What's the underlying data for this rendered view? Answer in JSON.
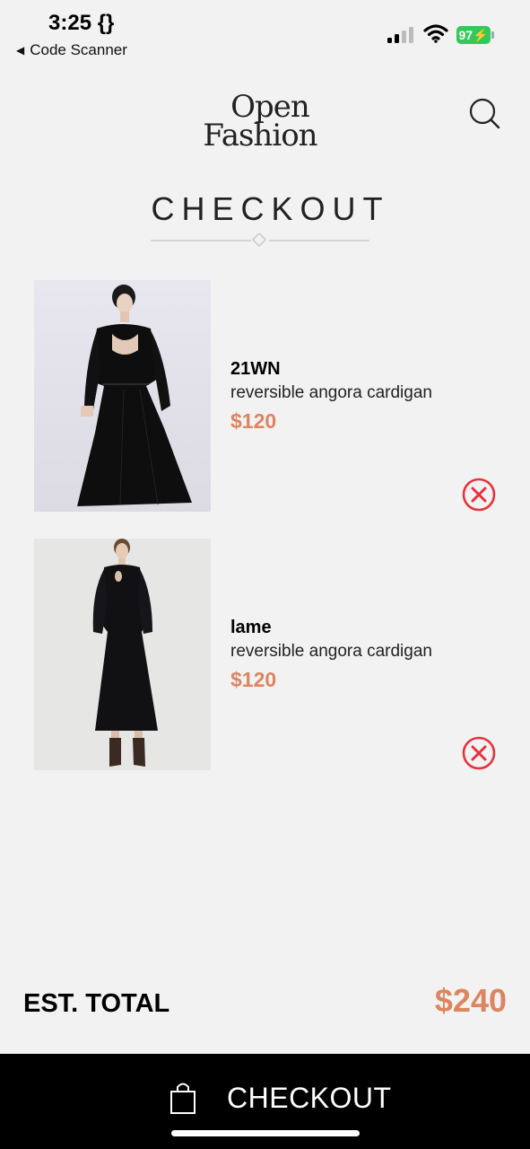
{
  "status_bar": {
    "time": "3:25 {}",
    "back_label": "Code Scanner",
    "battery": "97"
  },
  "brand": {
    "line1": "Open",
    "line2": "Fashion"
  },
  "icons": {
    "search": "search-icon",
    "remove": "close-circle-icon",
    "bag": "shopping-bag-icon"
  },
  "page": {
    "title": "CHECKOUT"
  },
  "cart": {
    "items": [
      {
        "brand": "21WN",
        "name": "reversible angora cardigan",
        "price": "$120"
      },
      {
        "brand": "lame",
        "name": "reversible angora cardigan",
        "price": "$120"
      }
    ]
  },
  "summary": {
    "total_label": "EST. TOTAL",
    "total_value": "$240"
  },
  "checkout_button": {
    "label": "CHECKOUT"
  },
  "colors": {
    "accent": "#dd8560",
    "remove": "#e5333e",
    "background": "#f2f2f2",
    "bar": "#000000"
  }
}
